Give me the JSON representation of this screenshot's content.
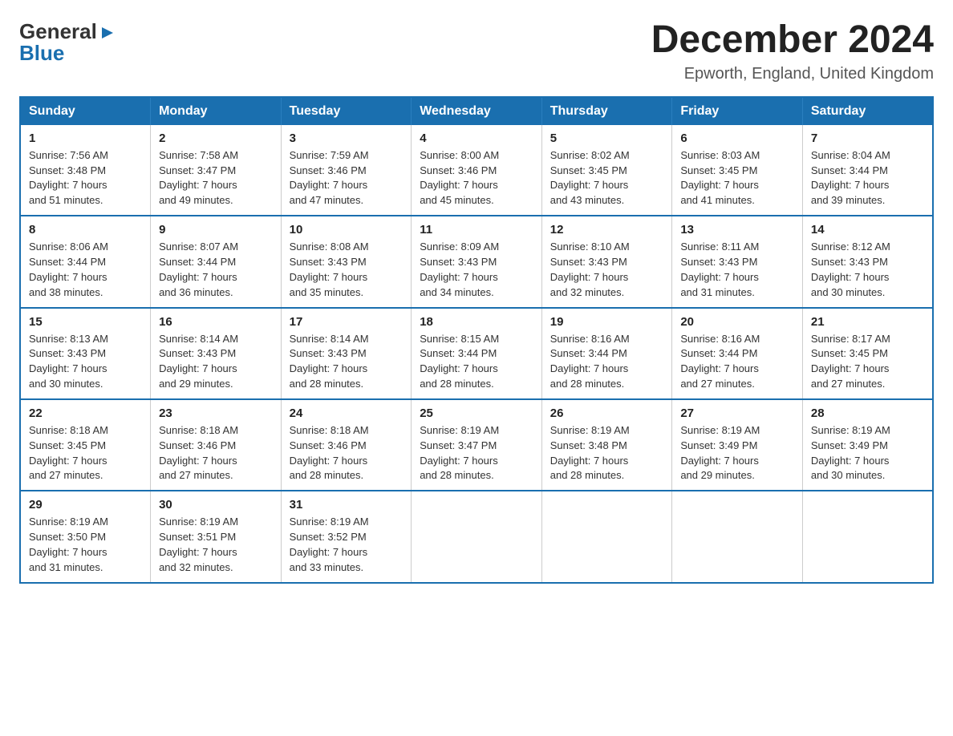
{
  "logo": {
    "general": "General",
    "blue": "Blue",
    "arrow_unicode": "▶"
  },
  "header": {
    "month": "December 2024",
    "location": "Epworth, England, United Kingdom"
  },
  "weekdays": [
    "Sunday",
    "Monday",
    "Tuesday",
    "Wednesday",
    "Thursday",
    "Friday",
    "Saturday"
  ],
  "weeks": [
    [
      {
        "day": "1",
        "sunrise": "7:56 AM",
        "sunset": "3:48 PM",
        "daylight": "7 hours and 51 minutes."
      },
      {
        "day": "2",
        "sunrise": "7:58 AM",
        "sunset": "3:47 PM",
        "daylight": "7 hours and 49 minutes."
      },
      {
        "day": "3",
        "sunrise": "7:59 AM",
        "sunset": "3:46 PM",
        "daylight": "7 hours and 47 minutes."
      },
      {
        "day": "4",
        "sunrise": "8:00 AM",
        "sunset": "3:46 PM",
        "daylight": "7 hours and 45 minutes."
      },
      {
        "day": "5",
        "sunrise": "8:02 AM",
        "sunset": "3:45 PM",
        "daylight": "7 hours and 43 minutes."
      },
      {
        "day": "6",
        "sunrise": "8:03 AM",
        "sunset": "3:45 PM",
        "daylight": "7 hours and 41 minutes."
      },
      {
        "day": "7",
        "sunrise": "8:04 AM",
        "sunset": "3:44 PM",
        "daylight": "7 hours and 39 minutes."
      }
    ],
    [
      {
        "day": "8",
        "sunrise": "8:06 AM",
        "sunset": "3:44 PM",
        "daylight": "7 hours and 38 minutes."
      },
      {
        "day": "9",
        "sunrise": "8:07 AM",
        "sunset": "3:44 PM",
        "daylight": "7 hours and 36 minutes."
      },
      {
        "day": "10",
        "sunrise": "8:08 AM",
        "sunset": "3:43 PM",
        "daylight": "7 hours and 35 minutes."
      },
      {
        "day": "11",
        "sunrise": "8:09 AM",
        "sunset": "3:43 PM",
        "daylight": "7 hours and 34 minutes."
      },
      {
        "day": "12",
        "sunrise": "8:10 AM",
        "sunset": "3:43 PM",
        "daylight": "7 hours and 32 minutes."
      },
      {
        "day": "13",
        "sunrise": "8:11 AM",
        "sunset": "3:43 PM",
        "daylight": "7 hours and 31 minutes."
      },
      {
        "day": "14",
        "sunrise": "8:12 AM",
        "sunset": "3:43 PM",
        "daylight": "7 hours and 30 minutes."
      }
    ],
    [
      {
        "day": "15",
        "sunrise": "8:13 AM",
        "sunset": "3:43 PM",
        "daylight": "7 hours and 30 minutes."
      },
      {
        "day": "16",
        "sunrise": "8:14 AM",
        "sunset": "3:43 PM",
        "daylight": "7 hours and 29 minutes."
      },
      {
        "day": "17",
        "sunrise": "8:14 AM",
        "sunset": "3:43 PM",
        "daylight": "7 hours and 28 minutes."
      },
      {
        "day": "18",
        "sunrise": "8:15 AM",
        "sunset": "3:44 PM",
        "daylight": "7 hours and 28 minutes."
      },
      {
        "day": "19",
        "sunrise": "8:16 AM",
        "sunset": "3:44 PM",
        "daylight": "7 hours and 28 minutes."
      },
      {
        "day": "20",
        "sunrise": "8:16 AM",
        "sunset": "3:44 PM",
        "daylight": "7 hours and 27 minutes."
      },
      {
        "day": "21",
        "sunrise": "8:17 AM",
        "sunset": "3:45 PM",
        "daylight": "7 hours and 27 minutes."
      }
    ],
    [
      {
        "day": "22",
        "sunrise": "8:18 AM",
        "sunset": "3:45 PM",
        "daylight": "7 hours and 27 minutes."
      },
      {
        "day": "23",
        "sunrise": "8:18 AM",
        "sunset": "3:46 PM",
        "daylight": "7 hours and 27 minutes."
      },
      {
        "day": "24",
        "sunrise": "8:18 AM",
        "sunset": "3:46 PM",
        "daylight": "7 hours and 28 minutes."
      },
      {
        "day": "25",
        "sunrise": "8:19 AM",
        "sunset": "3:47 PM",
        "daylight": "7 hours and 28 minutes."
      },
      {
        "day": "26",
        "sunrise": "8:19 AM",
        "sunset": "3:48 PM",
        "daylight": "7 hours and 28 minutes."
      },
      {
        "day": "27",
        "sunrise": "8:19 AM",
        "sunset": "3:49 PM",
        "daylight": "7 hours and 29 minutes."
      },
      {
        "day": "28",
        "sunrise": "8:19 AM",
        "sunset": "3:49 PM",
        "daylight": "7 hours and 30 minutes."
      }
    ],
    [
      {
        "day": "29",
        "sunrise": "8:19 AM",
        "sunset": "3:50 PM",
        "daylight": "7 hours and 31 minutes."
      },
      {
        "day": "30",
        "sunrise": "8:19 AM",
        "sunset": "3:51 PM",
        "daylight": "7 hours and 32 minutes."
      },
      {
        "day": "31",
        "sunrise": "8:19 AM",
        "sunset": "3:52 PM",
        "daylight": "7 hours and 33 minutes."
      },
      null,
      null,
      null,
      null
    ]
  ],
  "labels": {
    "sunrise": "Sunrise:",
    "sunset": "Sunset:",
    "daylight": "Daylight:"
  }
}
